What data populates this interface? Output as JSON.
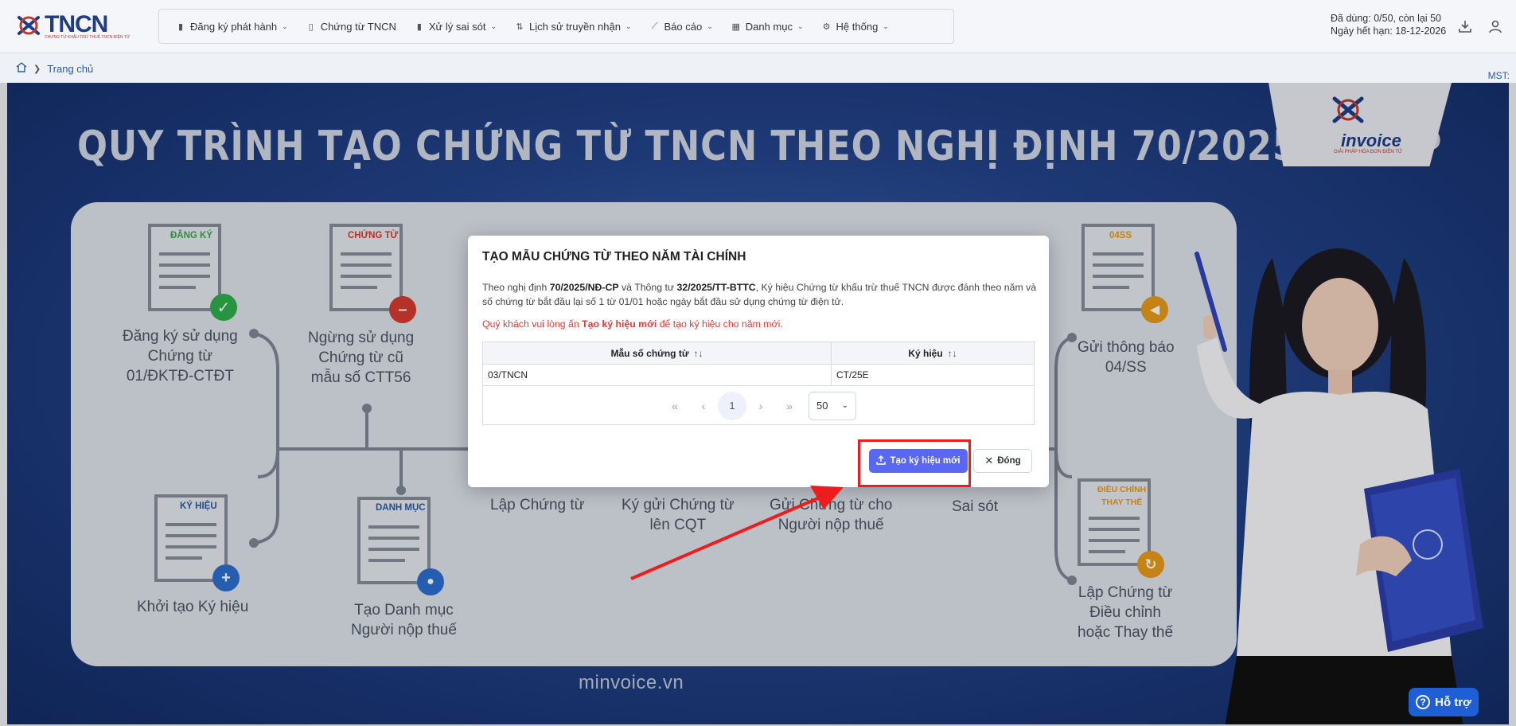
{
  "header": {
    "logo_text": "TNCN",
    "logo_sub": "CHỨNG TỪ KHẤU TRỪ THUẾ TNCN ĐIỆN TỬ",
    "nav": [
      {
        "label": "Đăng ký phát hành",
        "icon": "file-register-icon",
        "has_menu": true
      },
      {
        "label": "Chứng từ TNCN",
        "icon": "document-icon",
        "has_menu": false
      },
      {
        "label": "Xử lý sai sót",
        "icon": "file-error-icon",
        "has_menu": true
      },
      {
        "label": "Lịch sử truyền nhận",
        "icon": "transfer-icon",
        "has_menu": true
      },
      {
        "label": "Báo cáo",
        "icon": "chart-icon",
        "has_menu": true
      },
      {
        "label": "Danh mục",
        "icon": "grid-icon",
        "has_menu": true
      },
      {
        "label": "Hệ thống",
        "icon": "gear-icon",
        "has_menu": true
      }
    ],
    "quota_used": "Đã dùng: 0/50, còn lại 50",
    "expiry": "Ngày hết hạn: 18-12-2026"
  },
  "breadcrumb": {
    "home": "Trang chủ"
  },
  "mst_label": "MST:",
  "banner": {
    "title": "QUY TRÌNH TẠO CHỨNG TỪ TNCN THEO NGHỊ ĐỊNH 70/2025/NĐ-CP",
    "brand": "invoice",
    "brand_sub": "GIẢI PHÁP HÓA ĐƠN ĐIỆN TỬ",
    "site": "minvoice.vn",
    "steps": [
      {
        "tag": "ĐĂNG KÝ",
        "label": "Đăng ký sử dụng\nChứng từ\n01/ĐKTĐ-CTĐT"
      },
      {
        "tag": "CHỨNG TỪ",
        "label": "Ngừng sử dụng\nChứng từ cũ\nmẫu số CTT56"
      },
      {
        "tag": "04SS",
        "label": "Gửi thông báo\n04/SS"
      },
      {
        "tag": "KÝ HIỆU",
        "label": "Khởi tạo Ký hiệu"
      },
      {
        "tag": "DANH MỤC",
        "label": "Tạo Danh mục\nNgười nộp thuế"
      },
      {
        "tag": "",
        "label": "Lập Chứng từ"
      },
      {
        "tag": "",
        "label": "Ký gửi Chứng từ\nlên CQT"
      },
      {
        "tag": "",
        "label": "Gửi Chứng từ cho\nNgười nộp thuế"
      },
      {
        "tag": "",
        "label": "Sai sót"
      },
      {
        "tag": "ĐIỀU CHỈNH\nTHAY THẾ",
        "label": "Lập Chứng từ\nĐiều chỉnh\nhoặc Thay thế"
      }
    ]
  },
  "modal": {
    "title": "TẠO MẪU CHỨNG TỪ THEO NĂM TÀI CHÍNH",
    "desc_1": "Theo nghị định ",
    "desc_b1": "70/2025/NĐ-CP",
    "desc_2": " và Thông tư ",
    "desc_b2": "32/2025/TT-BTTC",
    "desc_3": ", Ký hiệu Chứng từ khấu trừ thuế TNCN được đánh theo năm và số chứng từ bắt đầu lại số 1 từ 01/01 hoặc ngày bắt đầu sử dụng chứng từ điện tử.",
    "warn_1": "Quý khách vui lòng ấn ",
    "warn_b": "Tạo ký hiệu mới",
    "warn_2": " để tạo ký hiệu cho năm mới.",
    "columns": [
      "Mẫu số chứng từ",
      "Ký hiệu"
    ],
    "rows": [
      {
        "mau_so": "03/TNCN",
        "ky_hieu": "CT/25E"
      }
    ],
    "page": "1",
    "page_size": "50",
    "create_label": "Tạo ký hiệu mới",
    "close_label": "Đóng"
  },
  "support_label": "Hỗ trợ",
  "colors": {
    "primary": "#5a67f0",
    "highlight": "#ee1c1c",
    "brand_blue": "#1f3c88"
  }
}
